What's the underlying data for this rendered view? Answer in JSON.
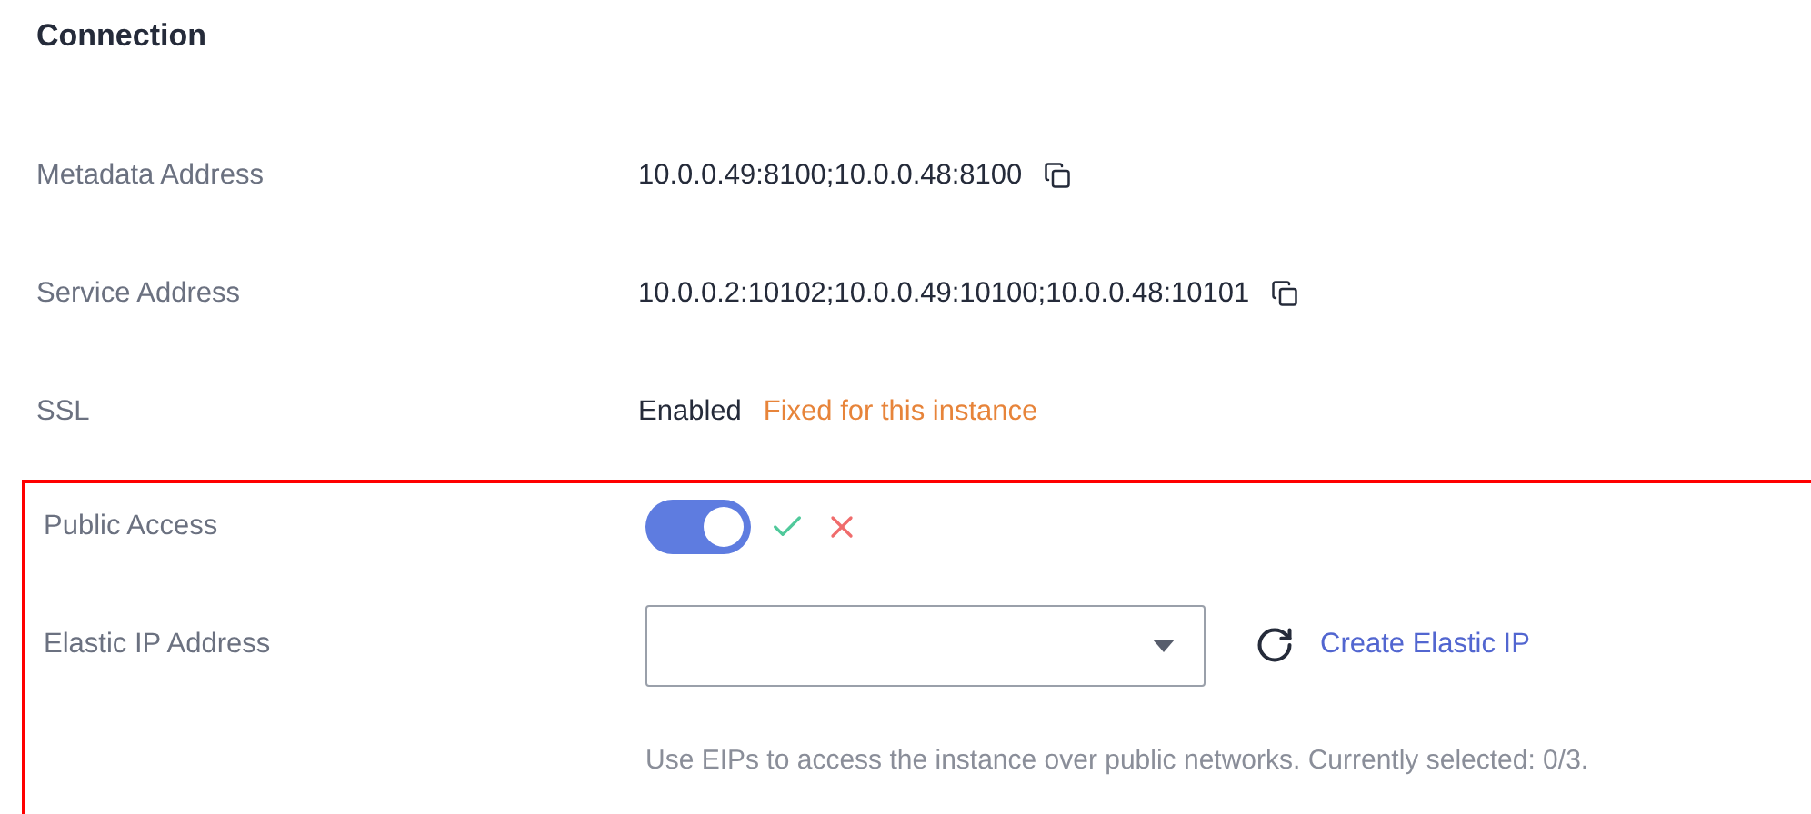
{
  "section": {
    "title": "Connection"
  },
  "fields": [
    {
      "kind": "copyable",
      "label": "Metadata Address",
      "value": "10.0.0.49:8100;10.0.0.48:8100"
    },
    {
      "kind": "copyable",
      "label": "Service Address",
      "value": "10.0.0.2:10102;10.0.0.49:10100;10.0.0.48:10101"
    },
    {
      "kind": "status",
      "label": "SSL",
      "value": "Enabled",
      "note": "Fixed for this instance"
    }
  ],
  "highlight": {
    "fields": [
      {
        "kind": "toggle",
        "label": "Public Access",
        "on": true
      },
      {
        "kind": "select",
        "label": "Elastic IP Address",
        "link": "Create Elastic IP",
        "hint": "Use EIPs to access the instance over public networks. Currently selected: 0/3."
      }
    ]
  }
}
